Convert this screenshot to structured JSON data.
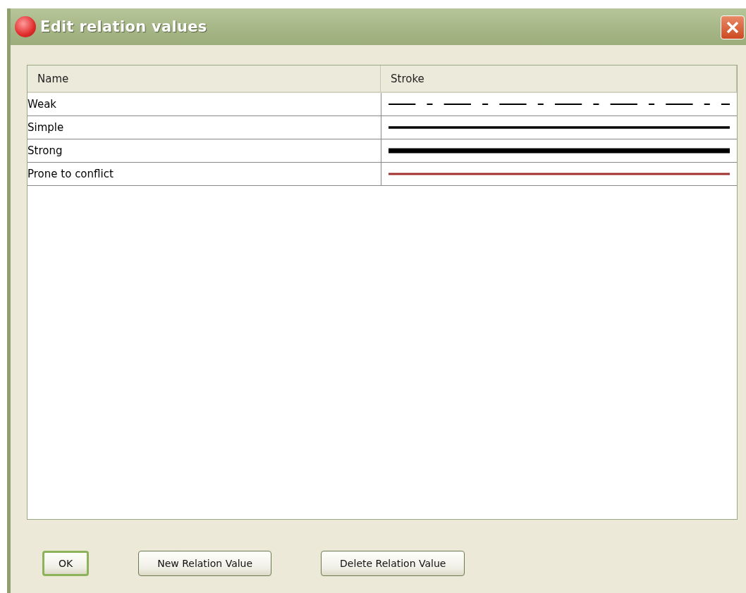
{
  "window": {
    "title": "Edit relation values"
  },
  "table": {
    "columns": [
      "Name",
      "Stroke"
    ],
    "rows": [
      {
        "name": "Weak",
        "kind": "dashed",
        "color": "#000000"
      },
      {
        "name": "Simple",
        "kind": "solid",
        "color": "#000000"
      },
      {
        "name": "Strong",
        "kind": "bold",
        "color": "#000000"
      },
      {
        "name": "Prone to conflict",
        "kind": "thin",
        "color": "#a0302c"
      }
    ]
  },
  "buttons": [
    {
      "label": "OK",
      "default": true
    },
    {
      "label": "New Relation Value",
      "default": false
    },
    {
      "label": "Delete Relation Value",
      "default": false
    }
  ]
}
